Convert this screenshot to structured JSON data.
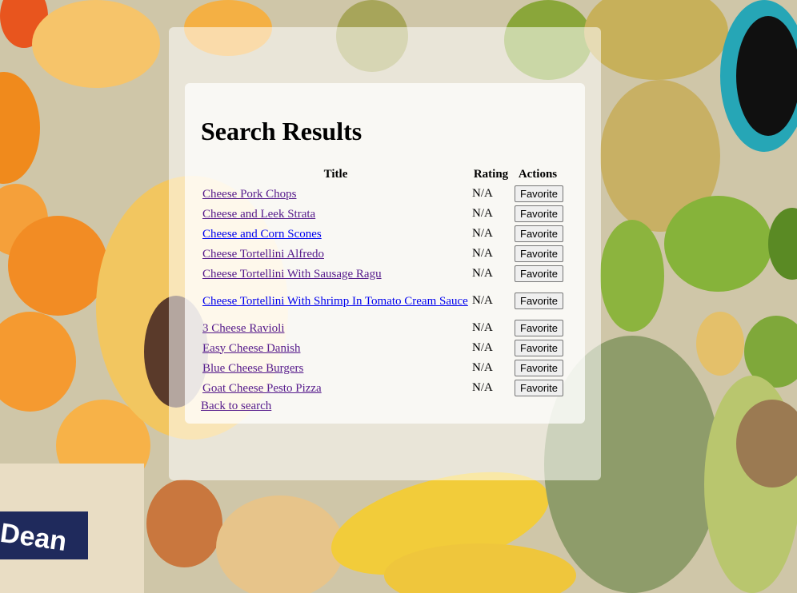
{
  "page": {
    "heading": "Search Results"
  },
  "table": {
    "headers": {
      "title": "Title",
      "rating": "Rating",
      "actions": "Actions"
    },
    "rows": [
      {
        "title": "Cheese Pork Chops",
        "rating": "N/A",
        "action": "Favorite",
        "visited": true
      },
      {
        "title": "Cheese and Leek Strata",
        "rating": "N/A",
        "action": "Favorite",
        "visited": true
      },
      {
        "title": "Cheese and Corn Scones",
        "rating": "N/A",
        "action": "Favorite",
        "visited": false
      },
      {
        "title": "Cheese Tortellini Alfredo",
        "rating": "N/A",
        "action": "Favorite",
        "visited": true
      },
      {
        "title": "Cheese Tortellini With Sausage Ragu",
        "rating": "N/A",
        "action": "Favorite",
        "visited": true
      },
      {
        "title": "Cheese Tortellini With Shrimp In Tomato Cream Sauce",
        "rating": "N/A",
        "action": "Favorite",
        "visited": false
      },
      {
        "title": "3 Cheese Ravioli",
        "rating": "N/A",
        "action": "Favorite",
        "visited": true
      },
      {
        "title": "Easy Cheese Danish",
        "rating": "N/A",
        "action": "Favorite",
        "visited": true
      },
      {
        "title": "Blue Cheese Burgers",
        "rating": "N/A",
        "action": "Favorite",
        "visited": true
      },
      {
        "title": "Goat Cheese Pesto Pizza",
        "rating": "N/A",
        "action": "Favorite",
        "visited": true
      }
    ]
  },
  "back_link": "Back to search",
  "colors": {
    "link": "#0000ee",
    "visited_link": "#551a8b"
  },
  "background_image_product_text": "Dean"
}
